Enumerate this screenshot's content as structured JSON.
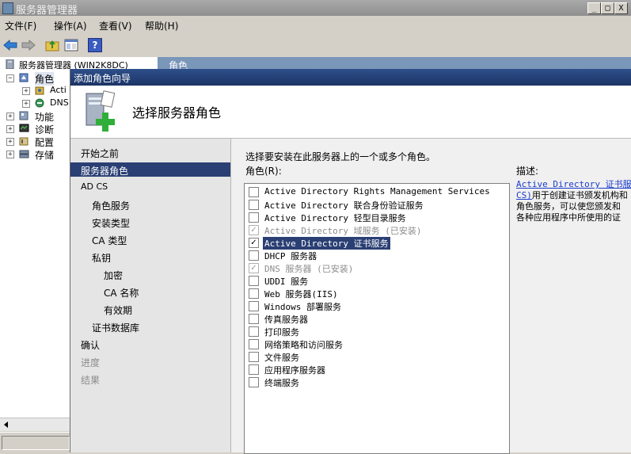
{
  "window": {
    "title": "服务器管理器",
    "min": "_",
    "max": "□",
    "close": "X"
  },
  "menu": [
    "文件(F)",
    "操作(A)",
    "查看(V)",
    "帮助(H)"
  ],
  "toolbar": [
    "back-icon",
    "forward-icon",
    "up-folder-icon",
    "properties-icon",
    "help-icon"
  ],
  "toolbar_help_glyph": "?",
  "tree": {
    "root": "服务器管理器 (WIN2K8DC)",
    "roles": "角色",
    "roles_children": [
      "Acti",
      "DNS"
    ],
    "features": "功能",
    "diagnostics": "诊断",
    "configuration": "配置",
    "storage": "存储"
  },
  "right_header": "角色",
  "dialog": {
    "title": "添加角色向导",
    "heading": "选择服务器角色",
    "nav": [
      {
        "label": "开始之前",
        "indent": 0,
        "state": "normal"
      },
      {
        "label": "服务器角色",
        "indent": 0,
        "state": "selected"
      },
      {
        "label": "AD CS",
        "indent": 0,
        "state": "normal"
      },
      {
        "label": "角色服务",
        "indent": 1,
        "state": "normal"
      },
      {
        "label": "安装类型",
        "indent": 1,
        "state": "normal"
      },
      {
        "label": "CA 类型",
        "indent": 1,
        "state": "normal"
      },
      {
        "label": "私钥",
        "indent": 1,
        "state": "normal"
      },
      {
        "label": "加密",
        "indent": 2,
        "state": "normal"
      },
      {
        "label": "CA 名称",
        "indent": 2,
        "state": "normal"
      },
      {
        "label": "有效期",
        "indent": 2,
        "state": "normal"
      },
      {
        "label": "证书数据库",
        "indent": 1,
        "state": "normal"
      },
      {
        "label": "确认",
        "indent": 0,
        "state": "normal"
      },
      {
        "label": "进度",
        "indent": 0,
        "state": "disabled"
      },
      {
        "label": "结果",
        "indent": 0,
        "state": "disabled"
      }
    ],
    "instruction": "选择要安装在此服务器上的一个或多个角色。",
    "roles_label": "角色(R):",
    "roles": [
      {
        "label": "Active Directory Rights Management Services",
        "checked": false,
        "disabled": false,
        "selected": false
      },
      {
        "label": "Active Directory 联合身份验证服务",
        "checked": false,
        "disabled": false,
        "selected": false
      },
      {
        "label": "Active Directory 轻型目录服务",
        "checked": false,
        "disabled": false,
        "selected": false
      },
      {
        "label": "Active Directory 域服务  (已安装)",
        "checked": true,
        "disabled": true,
        "selected": false
      },
      {
        "label": "Active Directory 证书服务",
        "checked": true,
        "disabled": false,
        "selected": true
      },
      {
        "label": "DHCP 服务器",
        "checked": false,
        "disabled": false,
        "selected": false
      },
      {
        "label": "DNS 服务器  (已安装)",
        "checked": true,
        "disabled": true,
        "selected": false
      },
      {
        "label": "UDDI 服务",
        "checked": false,
        "disabled": false,
        "selected": false
      },
      {
        "label": "Web 服务器(IIS)",
        "checked": false,
        "disabled": false,
        "selected": false
      },
      {
        "label": "Windows 部署服务",
        "checked": false,
        "disabled": false,
        "selected": false
      },
      {
        "label": "传真服务器",
        "checked": false,
        "disabled": false,
        "selected": false
      },
      {
        "label": "打印服务",
        "checked": false,
        "disabled": false,
        "selected": false
      },
      {
        "label": "网络策略和访问服务",
        "checked": false,
        "disabled": false,
        "selected": false
      },
      {
        "label": "文件服务",
        "checked": false,
        "disabled": false,
        "selected": false
      },
      {
        "label": "应用程序服务器",
        "checked": false,
        "disabled": false,
        "selected": false
      },
      {
        "label": "终端服务",
        "checked": false,
        "disabled": false,
        "selected": false
      }
    ],
    "check_glyph": "✓",
    "description_label": "描述:",
    "description_link1": "Active Directory 证书服务",
    "description_link2": "CS)",
    "description_rest1": "用于创建证书颁发机构和",
    "description_line3": "角色服务，可以使您颁发和",
    "description_line4": "各种应用程序中所使用的证"
  },
  "colors": {
    "accent": "#2a3f73",
    "link": "#1a3bcc"
  }
}
